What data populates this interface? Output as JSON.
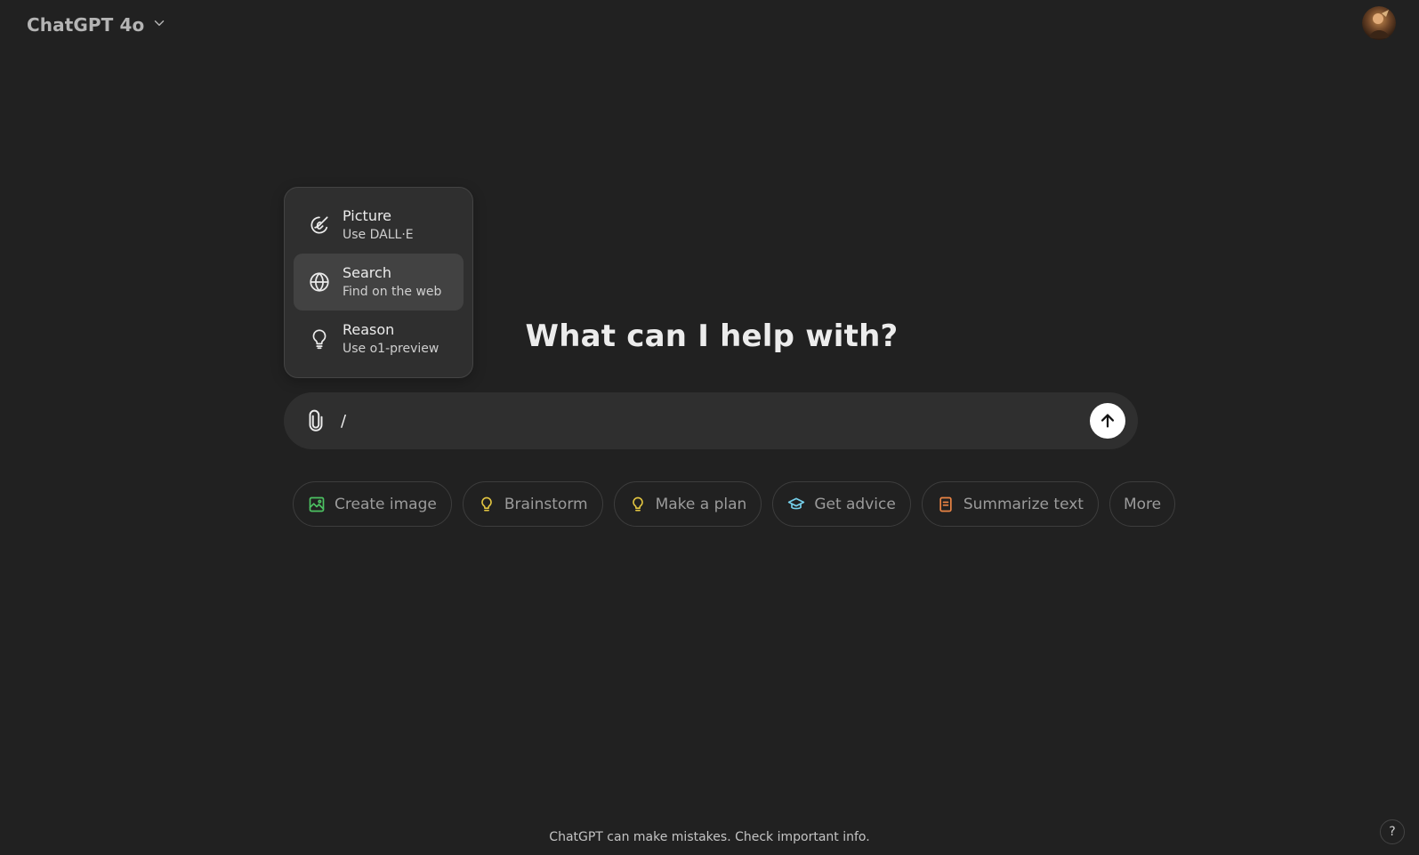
{
  "header": {
    "model_title": "ChatGPT 4o"
  },
  "popup_menu": {
    "items": [
      {
        "label": "Picture",
        "sublabel": "Use DALL·E",
        "icon": "dalle-brush-icon"
      },
      {
        "label": "Search",
        "sublabel": "Find on the web",
        "icon": "globe-icon",
        "active": true
      },
      {
        "label": "Reason",
        "sublabel": "Use o1-preview",
        "icon": "lightbulb-icon"
      }
    ]
  },
  "main": {
    "headline": "What can I help with?"
  },
  "composer": {
    "value": "/"
  },
  "suggestions": [
    {
      "label": "Create image",
      "icon": "image-icon",
      "color": "#4cc262"
    },
    {
      "label": "Brainstorm",
      "icon": "lightbulb-icon",
      "color": "#e2c541"
    },
    {
      "label": "Make a plan",
      "icon": "lightbulb-icon",
      "color": "#e2c541"
    },
    {
      "label": "Get advice",
      "icon": "graduation-cap-icon",
      "color": "#76d0eb"
    },
    {
      "label": "Summarize text",
      "icon": "document-icon",
      "color": "#ea8444"
    },
    {
      "label": "More"
    }
  ],
  "footer": {
    "disclaimer": "ChatGPT can make mistakes. Check important info.",
    "help_label": "?"
  }
}
